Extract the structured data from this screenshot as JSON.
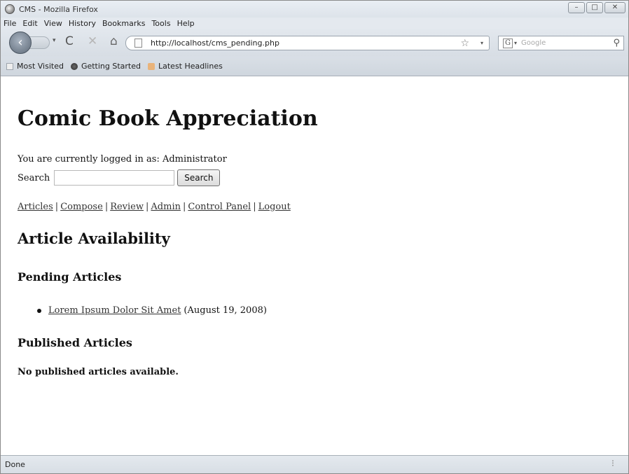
{
  "window": {
    "title": "CMS - Mozilla Firefox",
    "controls": {
      "minimize": "–",
      "maximize": "□",
      "close": "✕"
    }
  },
  "menu": [
    "File",
    "Edit",
    "View",
    "History",
    "Bookmarks",
    "Tools",
    "Help"
  ],
  "navbar": {
    "url": "http://localhost/cms_pending.php",
    "search_placeholder": "Google",
    "icons": {
      "back": "‹",
      "reload": "C",
      "stop": "✕",
      "home": "⌂",
      "bookmark_star": "☆",
      "dropdown": "▾",
      "search": "⚲",
      "engine": "G"
    }
  },
  "bookmarks": [
    "Most Visited",
    "Getting Started",
    "Latest Headlines"
  ],
  "page": {
    "site_title": "Comic Book Appreciation",
    "logged_in_text": "You are currently logged in as: Administrator",
    "search_label": "Search",
    "search_button": "Search",
    "nav_links": [
      "Articles",
      "Compose",
      "Review",
      "Admin",
      "Control Panel",
      "Logout"
    ],
    "nav_separator": "|",
    "heading": "Article Availability",
    "pending_heading": "Pending Articles",
    "pending_articles": [
      {
        "title": "Lorem Ipsum Dolor Sit Amet",
        "date": "(August 19, 2008)"
      }
    ],
    "published_heading": "Published Articles",
    "published_empty": "No published articles available."
  },
  "status": {
    "text": "Done",
    "grip": "⁝"
  }
}
